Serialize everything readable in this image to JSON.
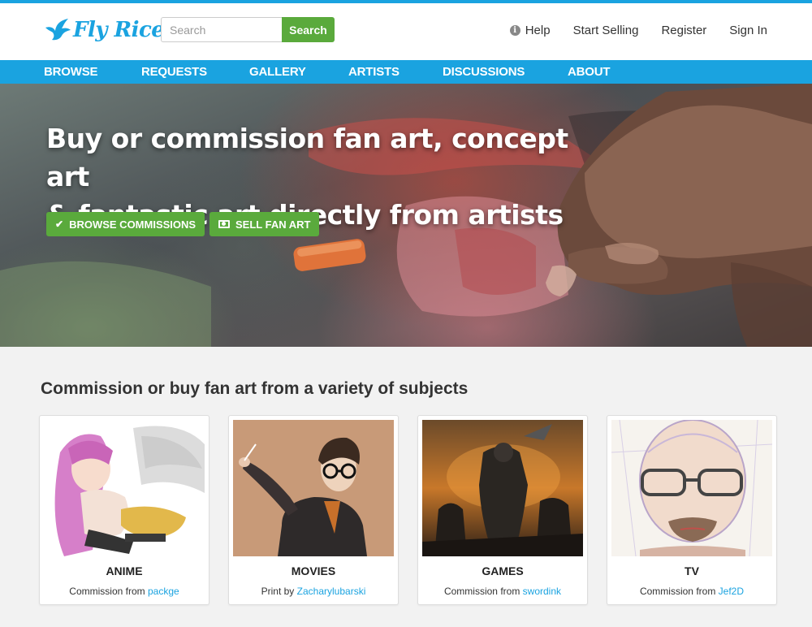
{
  "header": {
    "logo_text": "Fly Rice",
    "search_placeholder": "Search",
    "search_button": "Search",
    "links": {
      "help": "Help",
      "start_selling": "Start Selling",
      "register": "Register",
      "sign_in": "Sign In"
    }
  },
  "nav": {
    "items": [
      "BROWSE",
      "REQUESTS",
      "GALLERY",
      "ARTISTS",
      "DISCUSSIONS",
      "ABOUT"
    ]
  },
  "hero": {
    "headline_line1": "Buy or commission fan art, concept art",
    "headline_line2": "& fantastic art directly from artists",
    "browse_button": "BROWSE COMMISSIONS",
    "sell_button": "SELL FAN ART"
  },
  "subjects": {
    "title": "Commission or buy fan art from a variety of subjects",
    "cards": [
      {
        "title": "ANIME",
        "credit_prefix": "Commission from",
        "artist": "packge"
      },
      {
        "title": "MOVIES",
        "credit_prefix": "Print by",
        "artist": "Zacharylubarski"
      },
      {
        "title": "GAMES",
        "credit_prefix": "Commission from",
        "artist": "swordink"
      },
      {
        "title": "TV",
        "credit_prefix": "Commission from",
        "artist": "Jef2D"
      }
    ]
  },
  "colors": {
    "brand_blue": "#1aa3e0",
    "action_green": "#5aaa3c",
    "link_blue": "#1aa3e0"
  },
  "icons": {
    "logo": "bird-icon",
    "help": "info-icon",
    "browse_btn": "check-icon",
    "sell_btn": "cash-icon"
  }
}
